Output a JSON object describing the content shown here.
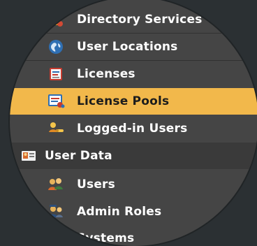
{
  "sidebar": {
    "items": [
      {
        "label": "Directory Services",
        "icon": "directory-services-icon"
      },
      {
        "label": "User Locations",
        "icon": "globe-icon"
      },
      {
        "label": "Licenses",
        "icon": "license-certificate-icon"
      },
      {
        "label": "License Pools",
        "icon": "license-pools-icon"
      },
      {
        "label": "Logged-in Users",
        "icon": "logged-in-users-icon"
      },
      {
        "label": "User Data",
        "icon": "user-data-card-icon"
      },
      {
        "label": "Users",
        "icon": "users-icon"
      },
      {
        "label": "Admin Roles",
        "icon": "admin-roles-icon"
      },
      {
        "label": "Systems",
        "icon": "systems-icon"
      }
    ]
  },
  "colors": {
    "background": "#2b3033",
    "panel": "#454545",
    "group_row": "#3a3a3a",
    "selected_row": "#f2b84b",
    "text": "#ffffff",
    "selected_text": "#1c1c1c"
  }
}
